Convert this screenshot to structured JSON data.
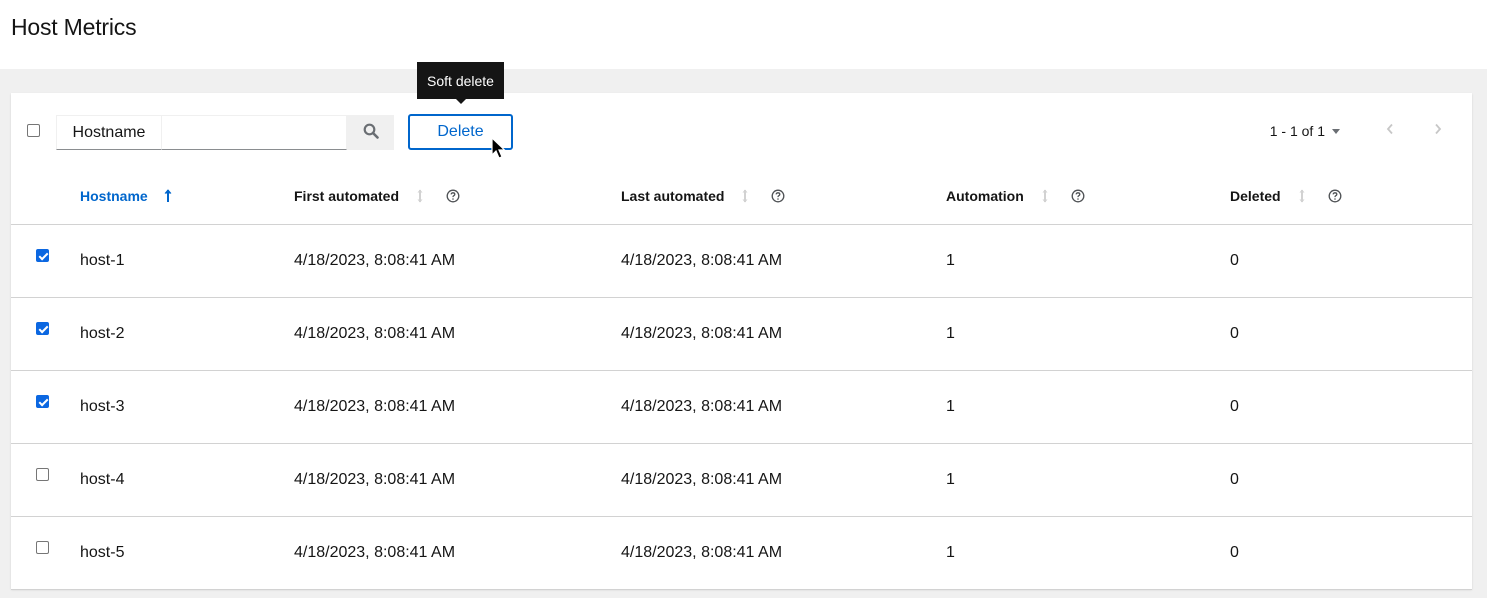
{
  "page": {
    "title": "Host Metrics"
  },
  "toolbar": {
    "filter_label": "Hostname",
    "filter_value": "",
    "search_icon": "search-icon",
    "delete_label": "Delete",
    "tooltip": "Soft delete",
    "pagination": {
      "range": "1 - 1 of 1"
    }
  },
  "table": {
    "columns": [
      {
        "label": "Hostname",
        "sorted": "asc"
      },
      {
        "label": "First automated"
      },
      {
        "label": "Last automated"
      },
      {
        "label": "Automation"
      },
      {
        "label": "Deleted"
      }
    ],
    "rows": [
      {
        "checked": true,
        "hostname": "host-1",
        "first_automated": "4/18/2023, 8:08:41 AM",
        "last_automated": "4/18/2023, 8:08:41 AM",
        "automation": "1",
        "deleted": "0"
      },
      {
        "checked": true,
        "hostname": "host-2",
        "first_automated": "4/18/2023, 8:08:41 AM",
        "last_automated": "4/18/2023, 8:08:41 AM",
        "automation": "1",
        "deleted": "0"
      },
      {
        "checked": true,
        "hostname": "host-3",
        "first_automated": "4/18/2023, 8:08:41 AM",
        "last_automated": "4/18/2023, 8:08:41 AM",
        "automation": "1",
        "deleted": "0"
      },
      {
        "checked": false,
        "hostname": "host-4",
        "first_automated": "4/18/2023, 8:08:41 AM",
        "last_automated": "4/18/2023, 8:08:41 AM",
        "automation": "1",
        "deleted": "0"
      },
      {
        "checked": false,
        "hostname": "host-5",
        "first_automated": "4/18/2023, 8:08:41 AM",
        "last_automated": "4/18/2023, 8:08:41 AM",
        "automation": "1",
        "deleted": "0"
      }
    ]
  },
  "colors": {
    "accent": "#0066cc",
    "checkbox_checked": "#0b67e1",
    "tooltip_bg": "#151515",
    "page_bg": "#f0f0f0"
  }
}
